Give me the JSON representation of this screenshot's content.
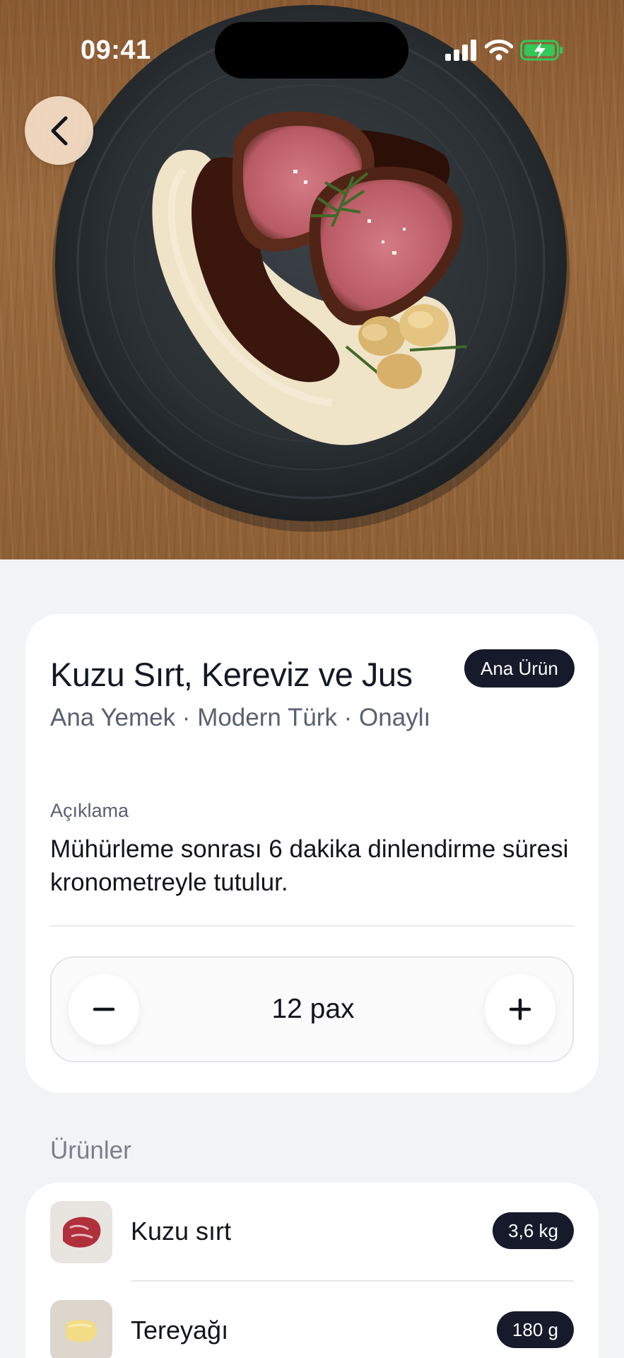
{
  "status_bar": {
    "time": "09:41",
    "icons": [
      "cellular-signal-icon",
      "wifi-icon",
      "battery-charging-icon"
    ]
  },
  "hero": {
    "image": "plated-lamb-loin-dish",
    "back_icon": "chevron-left-icon"
  },
  "dish": {
    "title": "Kuzu Sırt, Kereviz ve Jus",
    "badge": "Ana Ürün",
    "subtitle": "Ana Yemek · Modern Türk · Onaylı",
    "description_label": "Açıklama",
    "description": "Mühürleme sonrası 6 dakika dinlendirme süresi kronometreyle tutulur."
  },
  "stepper": {
    "value": "12 pax",
    "minus_icon": "minus-icon",
    "plus_icon": "plus-icon"
  },
  "products": {
    "section_title": "Ürünler",
    "items": [
      {
        "name": "Kuzu sırt",
        "quantity": "3,6 kg",
        "thumb": "raw-lamb-thumbnail"
      },
      {
        "name": "Tereyağı",
        "quantity": "180 g",
        "thumb": "butter-thumbnail"
      }
    ]
  },
  "colors": {
    "background": "#F2F3F5",
    "card": "#FFFFFF",
    "badge_dark": "#161A2A",
    "text_primary": "#12141A",
    "text_secondary": "#5A6070",
    "back_button": "#F5DEC8",
    "battery_green": "#34C759"
  }
}
